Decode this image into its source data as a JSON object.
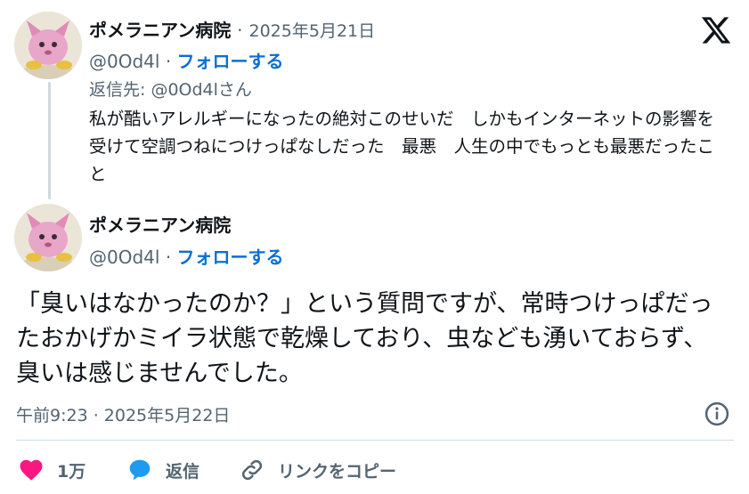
{
  "reply_tweet": {
    "display_name": "ポメラニアン病院",
    "separator": "·",
    "date": "2025年5月21日",
    "handle": "@0Od4l",
    "follow_label": "フォローする",
    "reply_to": "返信先: @0Od4lさん",
    "text": "私が酷いアレルギーになったの絶対このせいだ　しかもインターネットの影響を受けて空調つねにつけっぱなしだった　最悪　人生の中でもっとも最悪だったこと"
  },
  "main_tweet": {
    "display_name": "ポメラニアン病院",
    "handle": "@0Od4l",
    "separator": "·",
    "follow_label": "フォローする",
    "text": "「臭いはなかったのか？」という質問ですが、常時つけっぱだったおかげかミイラ状態で乾燥しており、虫なども湧いておらず、臭いは感じませんでした。",
    "timestamp": "午前9:23 · 2025年5月22日"
  },
  "actions": {
    "like_count": "1万",
    "reply_label": "返信",
    "copy_link_label": "リンクをコピー"
  },
  "icons": {
    "logo": "x-logo-icon",
    "info": "info-icon",
    "like": "heart-icon",
    "reply": "speech-bubble-icon",
    "link": "link-icon"
  },
  "colors": {
    "like": "#f91880",
    "reply": "#1d9bf0",
    "follow": "#0a6fd6",
    "muted": "#536471",
    "text": "#0f1419"
  }
}
